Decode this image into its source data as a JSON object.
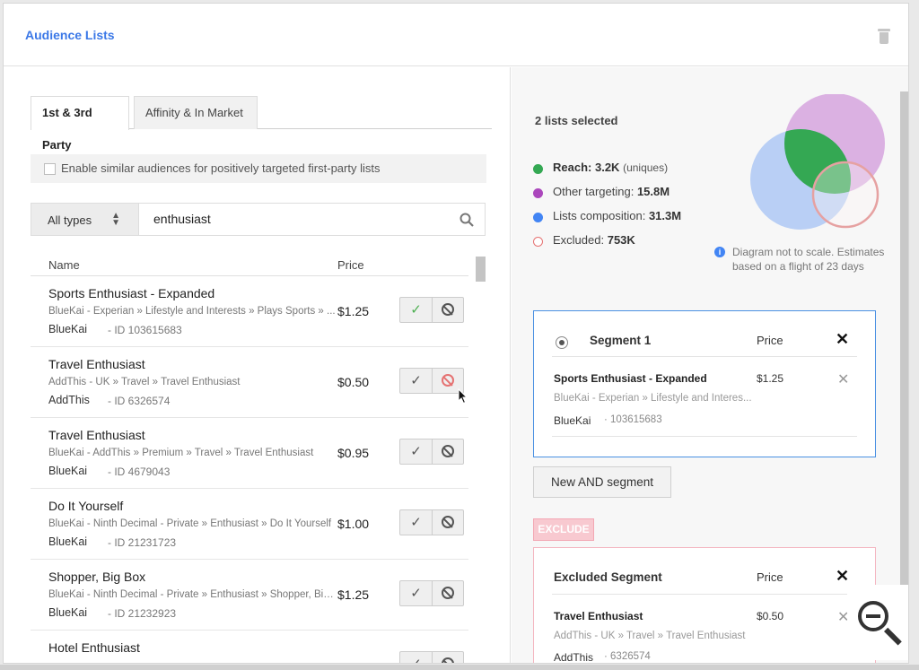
{
  "header": {
    "title": "Audience Lists",
    "trash_icon": "trash-icon"
  },
  "left": {
    "tabs": [
      {
        "label": "1st & 3rd Party",
        "active": true
      },
      {
        "label": "Affinity & In Market",
        "active": false
      }
    ],
    "similar_audiences": {
      "label": "Enable similar audiences for positively targeted first-party lists",
      "checked": false
    },
    "types_select": {
      "label": "All types"
    },
    "search": {
      "value": "enthusiast",
      "icon": "search-icon"
    },
    "table": {
      "headers": {
        "name": "Name",
        "price": "Price"
      },
      "rows": [
        {
          "title": "Sports Enthusiast - Expanded",
          "path": "BlueKai - Experian » Lifestyle and Interests » Plays Sports » ...",
          "provider": "BlueKai",
          "id": "- ID 103615683",
          "price": "$1.25",
          "state": "included"
        },
        {
          "title": "Travel Enthusiast",
          "path": "AddThis - UK » Travel » Travel Enthusiast",
          "provider": "AddThis",
          "id": "- ID 6326574",
          "price": "$0.50",
          "state": "excluded"
        },
        {
          "title": "Travel Enthusiast",
          "path": "BlueKai - AddThis » Premium » Travel » Travel Enthusiast",
          "provider": "BlueKai",
          "id": "- ID 4679043",
          "price": "$0.95",
          "state": "none"
        },
        {
          "title": "Do It Yourself",
          "path": "BlueKai - Ninth Decimal - Private » Enthusiast » Do It Yourself",
          "provider": "BlueKai",
          "id": "- ID 21231723",
          "price": "$1.00",
          "state": "none"
        },
        {
          "title": "Shopper, Big Box",
          "path": "BlueKai - Ninth Decimal - Private » Enthusiast » Shopper, Big...",
          "provider": "BlueKai",
          "id": "- ID 21232923",
          "price": "$1.25",
          "state": "none"
        },
        {
          "title": "Hotel Enthusiast",
          "path": "",
          "provider": "",
          "id": "",
          "price": "",
          "state": "none"
        }
      ]
    }
  },
  "right": {
    "lists_selected": "2 lists selected",
    "legend": [
      {
        "label": "Reach:",
        "value": "3.2K",
        "suffix": "(uniques)",
        "color": "#34a853",
        "style": "filled"
      },
      {
        "label": "Other targeting:",
        "value": "15.8M",
        "suffix": "",
        "color": "#ab47bc",
        "style": "filled"
      },
      {
        "label": "Lists composition:",
        "value": "31.3M",
        "suffix": "",
        "color": "#4285f4",
        "style": "filled"
      },
      {
        "label": "Excluded:",
        "value": "753K",
        "suffix": "",
        "color": "#e57373",
        "style": "outline"
      }
    ],
    "note": "Diagram not to scale. Estimates based on a flight of 23 days",
    "segment": {
      "title": "Segment 1",
      "price_header": "Price",
      "item": {
        "title": "Sports Enthusiast - Expanded",
        "price": "$1.25",
        "path": "BlueKai - Experian » Lifestyle and Interes...",
        "provider": "BlueKai",
        "id": "103615683"
      }
    },
    "new_and_segment": "New AND segment",
    "exclude_label": "EXCLUDE",
    "excluded_segment": {
      "title": "Excluded Segment",
      "price_header": "Price",
      "item": {
        "title": "Travel Enthusiast",
        "price": "$0.50",
        "path": "AddThis - UK » Travel » Travel Enthusiast",
        "provider": "AddThis",
        "id": "6326574"
      }
    }
  },
  "overlay": {
    "zoom_icon": "zoom-out-icon"
  }
}
